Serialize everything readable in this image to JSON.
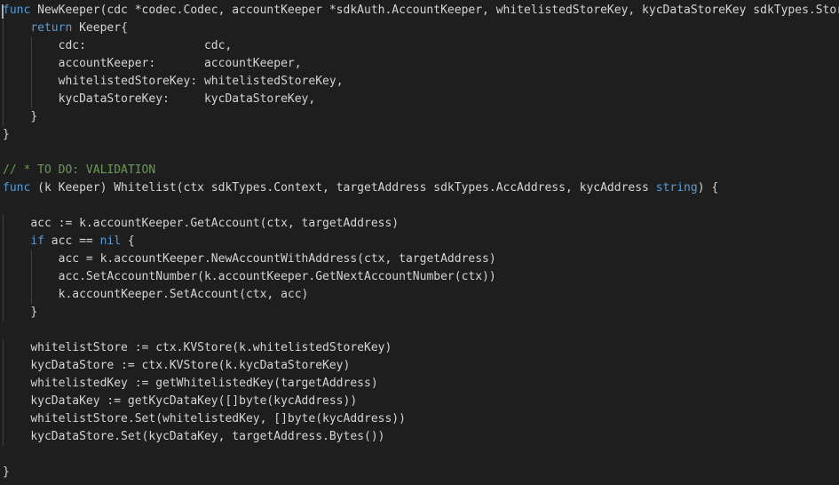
{
  "editor": {
    "language": "go",
    "theme_colors": {
      "background": "#1e1e1e",
      "keyword": "#569cd6",
      "comment": "#6a9955",
      "text": "#d4d4d4"
    },
    "lines": [
      {
        "indent": 0,
        "squiggle": true,
        "segments": [
          {
            "t": "k",
            "v": "func"
          },
          {
            "t": "t",
            "v": " NewKeeper(cdc *codec.Codec, accountKeeper *sdkAuth.AccountKeeper, whitelistedStoreKey, kycDataStoreKey sdkTypes.StoreKey"
          }
        ]
      },
      {
        "indent": 1,
        "segments": [
          {
            "t": "k",
            "v": "return"
          },
          {
            "t": "t",
            "v": " Keeper{"
          }
        ]
      },
      {
        "indent": 2,
        "segments": [
          {
            "t": "t",
            "v": "cdc:                 cdc,"
          }
        ]
      },
      {
        "indent": 2,
        "segments": [
          {
            "t": "t",
            "v": "accountKeeper:       accountKeeper,"
          }
        ]
      },
      {
        "indent": 2,
        "segments": [
          {
            "t": "t",
            "v": "whitelistedStoreKey: whitelistedStoreKey,"
          }
        ]
      },
      {
        "indent": 2,
        "segments": [
          {
            "t": "t",
            "v": "kycDataStoreKey:     kycDataStoreKey,"
          }
        ]
      },
      {
        "indent": 1,
        "segments": [
          {
            "t": "t",
            "v": "}"
          }
        ]
      },
      {
        "indent": 0,
        "segments": [
          {
            "t": "t",
            "v": "}"
          }
        ]
      },
      {
        "indent": 0,
        "segments": []
      },
      {
        "indent": 0,
        "squiggle": true,
        "segments": [
          {
            "t": "c",
            "v": "// * TO DO: VALIDATION"
          }
        ]
      },
      {
        "indent": 0,
        "segments": [
          {
            "t": "k",
            "v": "func"
          },
          {
            "t": "t",
            "v": " (k Keeper) Whitelist(ctx sdkTypes.Context, targetAddress sdkTypes.AccAddress, kycAddress "
          },
          {
            "t": "k",
            "v": "string"
          },
          {
            "t": "t",
            "v": ") {"
          }
        ]
      },
      {
        "indent": 0,
        "segments": []
      },
      {
        "indent": 1,
        "segments": [
          {
            "t": "t",
            "v": "acc := k.accountKeeper.GetAccount(ctx, targetAddress)"
          }
        ]
      },
      {
        "indent": 1,
        "segments": [
          {
            "t": "k",
            "v": "if"
          },
          {
            "t": "t",
            "v": " acc == "
          },
          {
            "t": "k",
            "v": "nil"
          },
          {
            "t": "t",
            "v": " {"
          }
        ]
      },
      {
        "indent": 2,
        "segments": [
          {
            "t": "t",
            "v": "acc = k.accountKeeper.NewAccountWithAddress(ctx, targetAddress)"
          }
        ]
      },
      {
        "indent": 2,
        "segments": [
          {
            "t": "t",
            "v": "acc.SetAccountNumber(k.accountKeeper.GetNextAccountNumber(ctx))"
          }
        ]
      },
      {
        "indent": 2,
        "segments": [
          {
            "t": "t",
            "v": "k.accountKeeper.SetAccount(ctx, acc)"
          }
        ]
      },
      {
        "indent": 1,
        "segments": [
          {
            "t": "t",
            "v": "}"
          }
        ]
      },
      {
        "indent": 0,
        "segments": []
      },
      {
        "indent": 1,
        "segments": [
          {
            "t": "t",
            "v": "whitelistStore := ctx.KVStore(k.whitelistedStoreKey)"
          }
        ]
      },
      {
        "indent": 1,
        "segments": [
          {
            "t": "t",
            "v": "kycDataStore := ctx.KVStore(k.kycDataStoreKey)"
          }
        ]
      },
      {
        "indent": 1,
        "segments": [
          {
            "t": "t",
            "v": "whitelistedKey := getWhitelistedKey(targetAddress)"
          }
        ]
      },
      {
        "indent": 1,
        "segments": [
          {
            "t": "t",
            "v": "kycDataKey := getKycDataKey([]byte(kycAddress))"
          }
        ]
      },
      {
        "indent": 1,
        "segments": [
          {
            "t": "t",
            "v": "whitelistStore.Set(whitelistedKey, []byte(kycAddress))"
          }
        ]
      },
      {
        "indent": 1,
        "segments": [
          {
            "t": "t",
            "v": "kycDataStore.Set(kycDataKey, targetAddress.Bytes())"
          }
        ]
      },
      {
        "indent": 0,
        "segments": []
      },
      {
        "indent": 0,
        "segments": [
          {
            "t": "t",
            "v": "}"
          }
        ]
      }
    ]
  }
}
